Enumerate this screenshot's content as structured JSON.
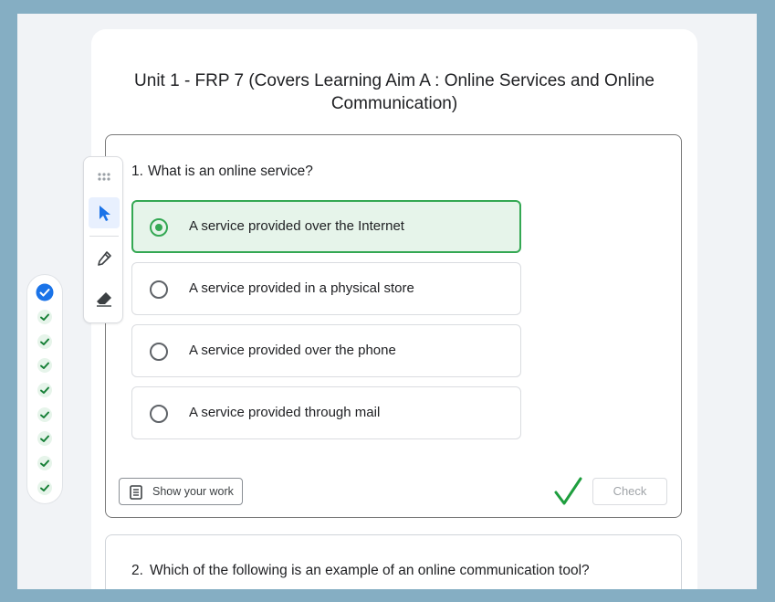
{
  "quiz": {
    "title": "Unit 1 - FRP 7 (Covers Learning Aim A : Online Services and Online Communication)"
  },
  "questions": [
    {
      "number": "1.",
      "text": "What is an online service?",
      "options": [
        {
          "label": "A service provided over the Internet",
          "selected": true
        },
        {
          "label": "A service provided in a physical store",
          "selected": false
        },
        {
          "label": "A service provided over the phone",
          "selected": false
        },
        {
          "label": "A service provided through mail",
          "selected": false
        }
      ],
      "show_work_label": "Show your work",
      "check_label": "Check",
      "status_icon": "checkmark-icon"
    },
    {
      "number": "2.",
      "text": "Which of the following is an example of an online communication tool?"
    }
  ],
  "toolbar": {
    "tools": [
      "drag-handle-icon",
      "pointer-icon",
      "pen-icon",
      "eraser-icon"
    ],
    "active_tool": "pointer"
  },
  "progress": {
    "items": [
      "current",
      "correct",
      "correct",
      "correct",
      "correct",
      "correct",
      "correct",
      "correct",
      "correct",
      "correct"
    ]
  },
  "colors": {
    "accent": "#1a73e8",
    "correct": "#34a853",
    "selected_bg": "#e6f4ea",
    "background": "#85aec3"
  }
}
